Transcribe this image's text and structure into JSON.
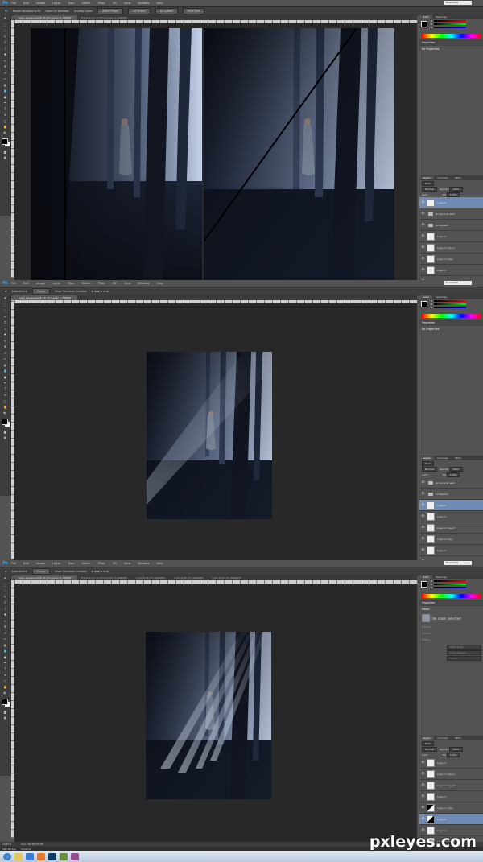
{
  "app": {
    "logo": "Ps"
  },
  "menu": [
    "File",
    "Edit",
    "Image",
    "Layer",
    "Type",
    "Select",
    "Filter",
    "3D",
    "View",
    "Window",
    "Help"
  ],
  "workspace": "Essentials",
  "shots": [
    {
      "options": {
        "tool_icons": [
          "zoom-icon"
        ],
        "checkboxes": [
          "Resize Windows to Fit",
          "Zoom All Windows",
          "Scrubby Zoom"
        ],
        "buttons": [
          "Actual Pixels",
          "Fit Screen",
          "Fill Screen",
          "Print Size"
        ]
      },
      "tabs": [
        {
          "label": "scary woods.psd @ 25.2% (Layer 5, RGB/8) *",
          "active": true
        },
        {
          "label": "fire ntrs.psd @ 25% (Layer 0, RGB/8#)",
          "active": false
        }
      ],
      "color_panel_tabs": [
        "Color",
        "Swatches"
      ],
      "properties_title": "Properties",
      "properties_text": "No Properties",
      "layers_tabs": [
        "Layers",
        "Channels",
        "Paths"
      ],
      "filter_kind": "Kind",
      "blend_mode": "Normal",
      "opacity_label": "Opacity:",
      "opacity_value": "100%",
      "lock_label": "Lock:",
      "fill_label": "Fill:",
      "fill_value": "100%",
      "layers": [
        {
          "name": "Layer 5",
          "type": "layer",
          "selected": true
        },
        {
          "name": "Group over wed",
          "type": "group",
          "selected": false
        },
        {
          "name": "Lichtgloed",
          "type": "group",
          "selected": false
        },
        {
          "name": "Layer 3",
          "type": "layer",
          "selected": false
        },
        {
          "name": "Layer 4 copy 2",
          "type": "layer",
          "selected": false
        },
        {
          "name": "Layer 4 copy",
          "type": "layer",
          "selected": false
        },
        {
          "name": "Layer 4",
          "type": "layer",
          "selected": false
        },
        {
          "name": "Groen",
          "type": "group",
          "selected": false
        },
        {
          "name": "Schaal",
          "type": "group",
          "selected": false
        },
        {
          "name": "Background",
          "type": "group",
          "selected": false
        }
      ]
    },
    {
      "options": {
        "checkboxes": [
          "Auto-Select:",
          "Show Transform Controls"
        ],
        "select_value": "Group"
      },
      "tabs": [
        {
          "label": "scary woods.psd @ 16.7% (Layer 5, RGB/8) *",
          "active": true
        }
      ],
      "color_panel_tabs": [
        "Color",
        "Swatches"
      ],
      "properties_title": "Properties",
      "properties_text": "No Properties",
      "layers_tabs": [
        "Layers",
        "Channels",
        "Paths"
      ],
      "filter_kind": "Kind",
      "blend_mode": "Normal",
      "opacity_label": "Opacity:",
      "opacity_value": "100%",
      "lock_label": "Lock:",
      "fill_label": "Fill:",
      "fill_value": "100%",
      "layers": [
        {
          "name": "Group over wed",
          "type": "group",
          "selected": false
        },
        {
          "name": "Lichtgloed",
          "type": "group",
          "selected": false
        },
        {
          "name": "Layer 5",
          "type": "layer",
          "selected": true
        },
        {
          "name": "Layer 3",
          "type": "layer",
          "selected": false
        },
        {
          "name": "Layer 4 copy 2",
          "type": "layer",
          "selected": false
        },
        {
          "name": "Layer 4 copy",
          "type": "layer",
          "selected": false
        },
        {
          "name": "Layer 4",
          "type": "layer",
          "selected": false
        },
        {
          "name": "Groen",
          "type": "group",
          "selected": false
        },
        {
          "name": "Schaal",
          "type": "group",
          "selected": false
        }
      ]
    },
    {
      "options": {
        "checkboxes": [
          "Auto-Select:",
          "Show Transform Controls"
        ],
        "select_value": "Group"
      },
      "tabs": [
        {
          "label": "scary woods.psd @ 16.7% (Layer 5, RGB/8) *",
          "active": true
        },
        {
          "label": "fire ntrs.psd @ 25% (Layer 0, RGB/8#)",
          "active": false
        },
        {
          "label": "1.jpg @ 66.7% (RGB/8#)",
          "active": false
        },
        {
          "label": "2.jpg @ 66.7% (RGB/8#)",
          "active": false
        },
        {
          "label": "3.jpg @ 66.7% (RGB/8#)",
          "active": false
        }
      ],
      "color_panel_tabs": [
        "Color",
        "Swatches"
      ],
      "properties_title": "Properties",
      "masks_title": "Masks",
      "mask_text": "No mask selected",
      "density_label": "Density:",
      "feather_label": "Feather:",
      "refine_label": "Refine:",
      "refine_buttons": [
        "Mask Edge...",
        "Color Range...",
        "Invert"
      ],
      "layers_tabs": [
        "Layers",
        "Channels",
        "Paths"
      ],
      "filter_kind": "Kind",
      "blend_mode": "Normal",
      "opacity_label": "Opacity:",
      "opacity_value": "100%",
      "lock_label": "Lock:",
      "fill_label": "Fill:",
      "fill_value": "100%",
      "layers": [
        {
          "name": "Layer 3",
          "type": "layer",
          "selected": false
        },
        {
          "name": "Layer 1 copy 2",
          "type": "layer",
          "selected": false
        },
        {
          "name": "Layer 1 copy 2",
          "type": "layer",
          "selected": false
        },
        {
          "name": "Layer 1",
          "type": "layer",
          "selected": false
        },
        {
          "name": "Layer 1 copy",
          "type": "mask",
          "selected": false
        },
        {
          "name": "Layer 2",
          "type": "mask2",
          "selected": true
        },
        {
          "name": "Layer 1",
          "type": "layer",
          "selected": false
        },
        {
          "name": "Layer 1 copy 2",
          "type": "layer",
          "selected": false
        }
      ]
    }
  ],
  "status": {
    "zoom": "16.67%",
    "doc": "Doc: 26.4M/74.2M",
    "tabs": [
      "Mini Bridge",
      "Timeline"
    ]
  },
  "watermark": "pxleyes.com",
  "colors": {
    "panel": "#535353",
    "dark": "#3c3c3c",
    "canvas": "#282828",
    "selection": "#6f8bb3",
    "accent": "#31a8ff"
  }
}
